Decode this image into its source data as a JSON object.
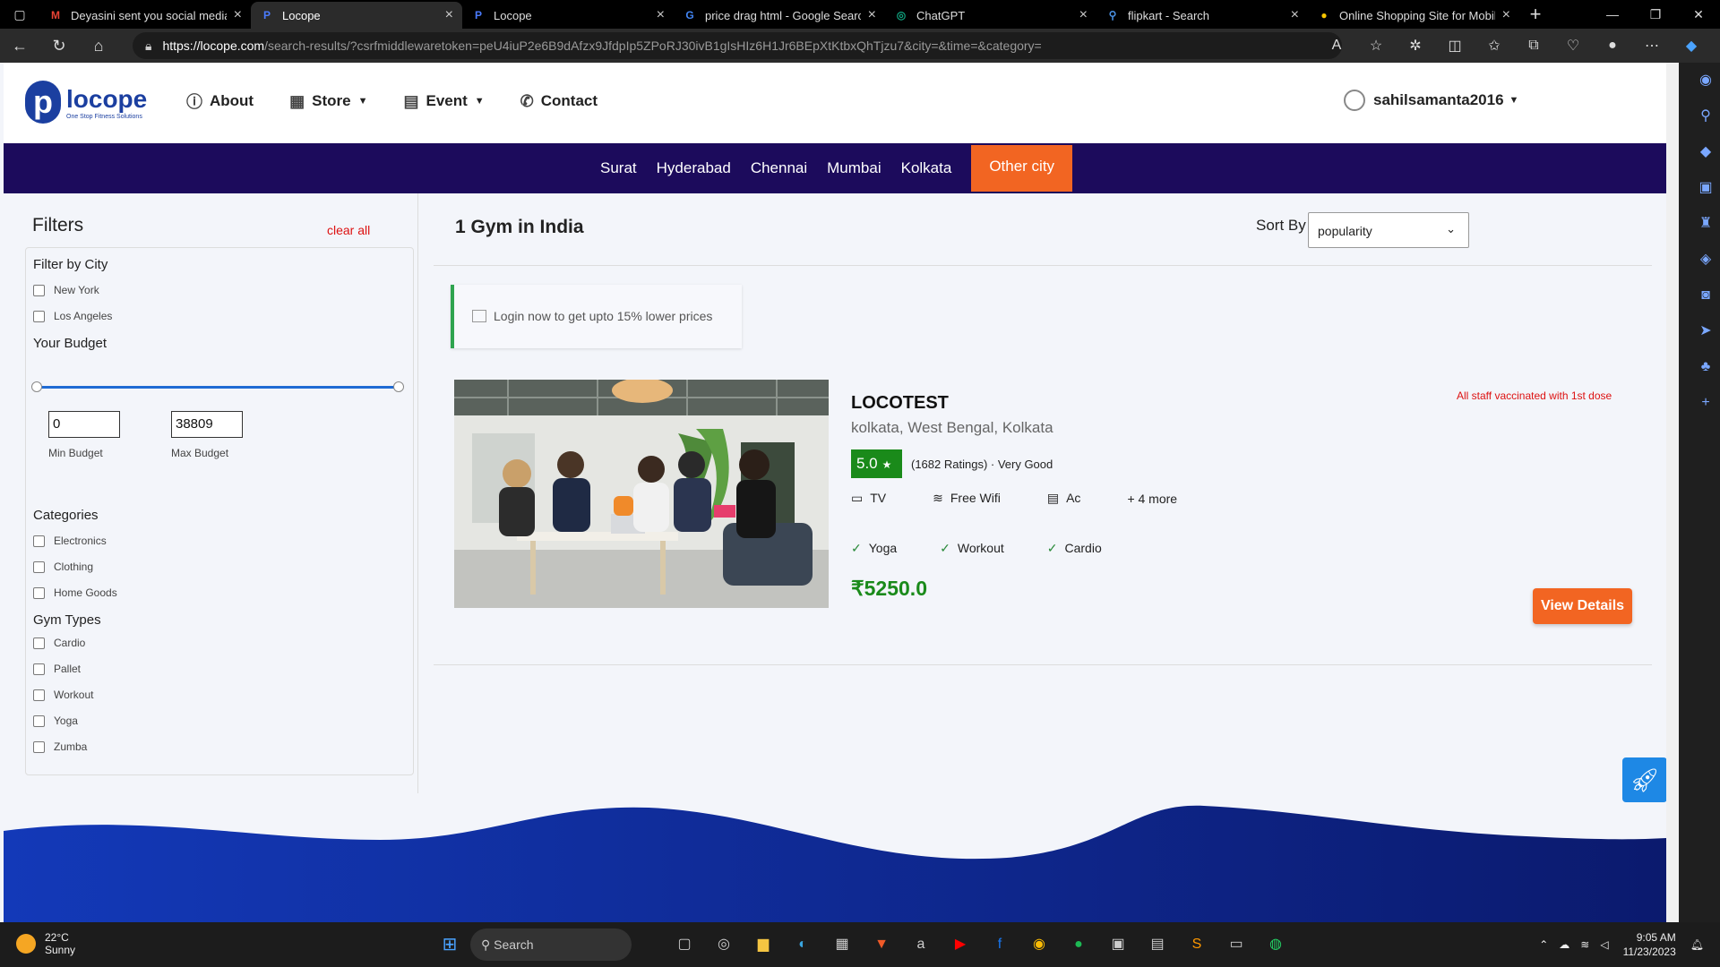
{
  "browser": {
    "tabs": [
      {
        "title": "Deyasini sent you social media v",
        "icon": "gmail-icon",
        "active": false
      },
      {
        "title": "Locope",
        "icon": "locope-icon",
        "active": true
      },
      {
        "title": "Locope",
        "icon": "locope-icon",
        "active": false
      },
      {
        "title": "price drag html - Google Search",
        "icon": "google-icon",
        "active": false
      },
      {
        "title": "ChatGPT",
        "icon": "chatgpt-icon",
        "active": false
      },
      {
        "title": "flipkart - Search",
        "icon": "search-icon",
        "active": false
      },
      {
        "title": "Online Shopping Site for Mobile",
        "icon": "flipkart-icon",
        "active": false
      }
    ],
    "url_domain": "https://locope.com",
    "url_path": "/search-results/?csrfmiddlewaretoken=peU4iuP2e6B9dAfzx9JfdpIp5ZPoRJ30ivB1gIsHIz6H1Jr6BEpXtKtbxQhTjzu7&city=&time=&category="
  },
  "header": {
    "logo_text": "locope",
    "logo_tagline": "One Stop Fitness Solutions",
    "nav": {
      "about": "About",
      "store": "Store",
      "event": "Event",
      "contact": "Contact"
    },
    "user": "sahilsamanta2016"
  },
  "cities": [
    "Surat",
    "Hyderabad",
    "Chennai",
    "Mumbai",
    "Kolkata"
  ],
  "other_city": "Other city",
  "filters": {
    "title": "Filters",
    "clear_all": "clear all",
    "city_heading": "Filter by City",
    "cities": [
      "New York",
      "Los Angeles"
    ],
    "budget_heading": "Your Budget",
    "min_value": "0",
    "max_value": "38809",
    "min_label": "Min Budget",
    "max_label": "Max Budget",
    "categories_heading": "Categories",
    "categories": [
      "Electronics",
      "Clothing",
      "Home Goods"
    ],
    "gym_types_heading": "Gym Types",
    "gym_types": [
      "Cardio",
      "Pallet",
      "Workout",
      "Yoga",
      "Zumba"
    ]
  },
  "results": {
    "title": "1 Gym in India",
    "sort_label": "Sort By",
    "sort_value": "popularity",
    "login_promo": "Login now to get upto 15% lower prices"
  },
  "gym": {
    "name": "LOCOTEST",
    "location": "kolkata, West Bengal, Kolkata",
    "vaccination": "All staff vaccinated with 1st dose",
    "rating": "5.0",
    "rating_text": "(1682 Ratings) · Very Good",
    "amenities": [
      "TV",
      "Free Wifi",
      "Ac"
    ],
    "more_amenities": "+ 4 more",
    "types": [
      "Yoga",
      "Workout",
      "Cardio"
    ],
    "price": "₹5250.0",
    "view_button": "View Details"
  },
  "taskbar": {
    "temperature": "22°C",
    "weather": "Sunny",
    "search_label": "Search",
    "time": "9:05 AM",
    "date": "11/23/2023"
  },
  "colors": {
    "brand": "#1b3fa0",
    "citybar": "#1c0b5c",
    "accent": "#f26522",
    "price": "#1a8a1a",
    "alert": "#dd1111"
  }
}
